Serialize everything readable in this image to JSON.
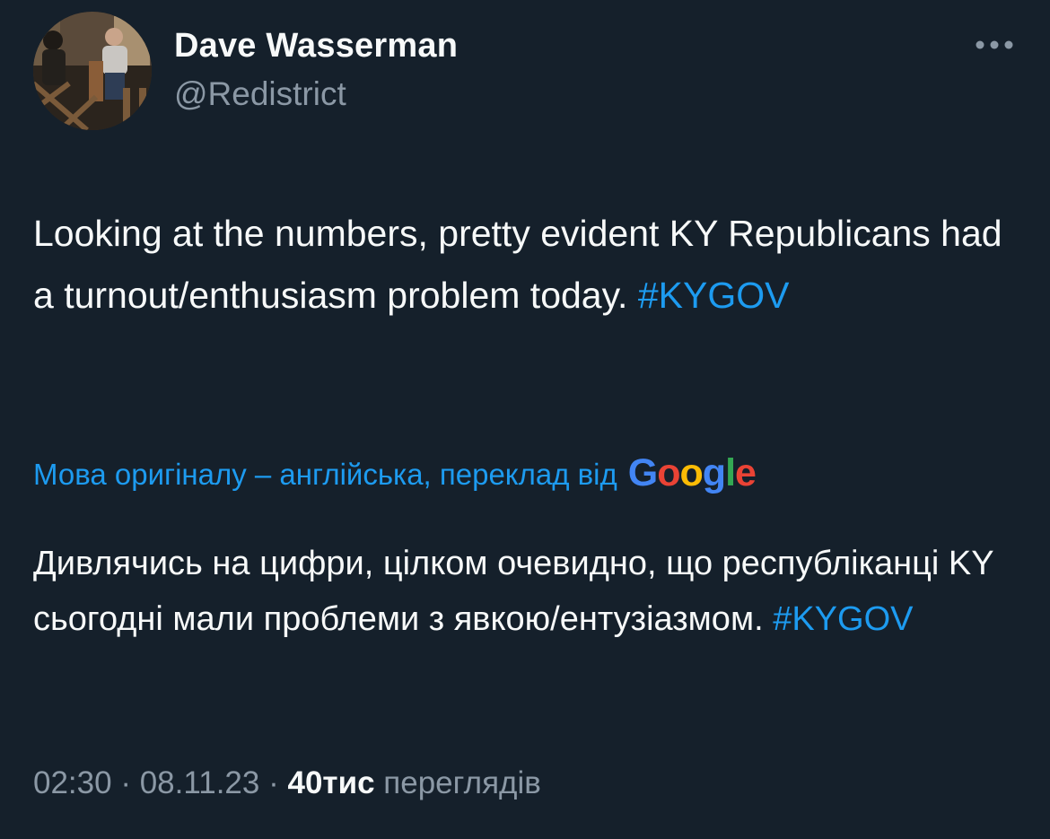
{
  "author": {
    "name": "Dave Wasserman",
    "handle": "@Redistrict"
  },
  "tweet": {
    "text": "Looking at the numbers, pretty evident KY Republicans had a turnout/enthusiasm problem today.",
    "hashtag": "#KYGOV"
  },
  "translation": {
    "note": "Мова оригіналу – англійська, переклад від",
    "provider": "Google",
    "text": "Дивлячись на цифри, цілком очевидно, що республіканці KY сьогодні мали проблеми з явкою/ентузіазмом.",
    "hashtag": "#KYGOV"
  },
  "meta": {
    "time": "02:30",
    "separator": "·",
    "date": "08.11.23",
    "views_count": "40тис",
    "views_label": "переглядів"
  },
  "icons": {
    "more": "more-horizontal-icon",
    "avatar": "avatar-photo"
  },
  "colors": {
    "background": "#15202b",
    "text": "#f7f9f9",
    "secondary": "#8b98a5",
    "accent": "#1d9bf0"
  }
}
